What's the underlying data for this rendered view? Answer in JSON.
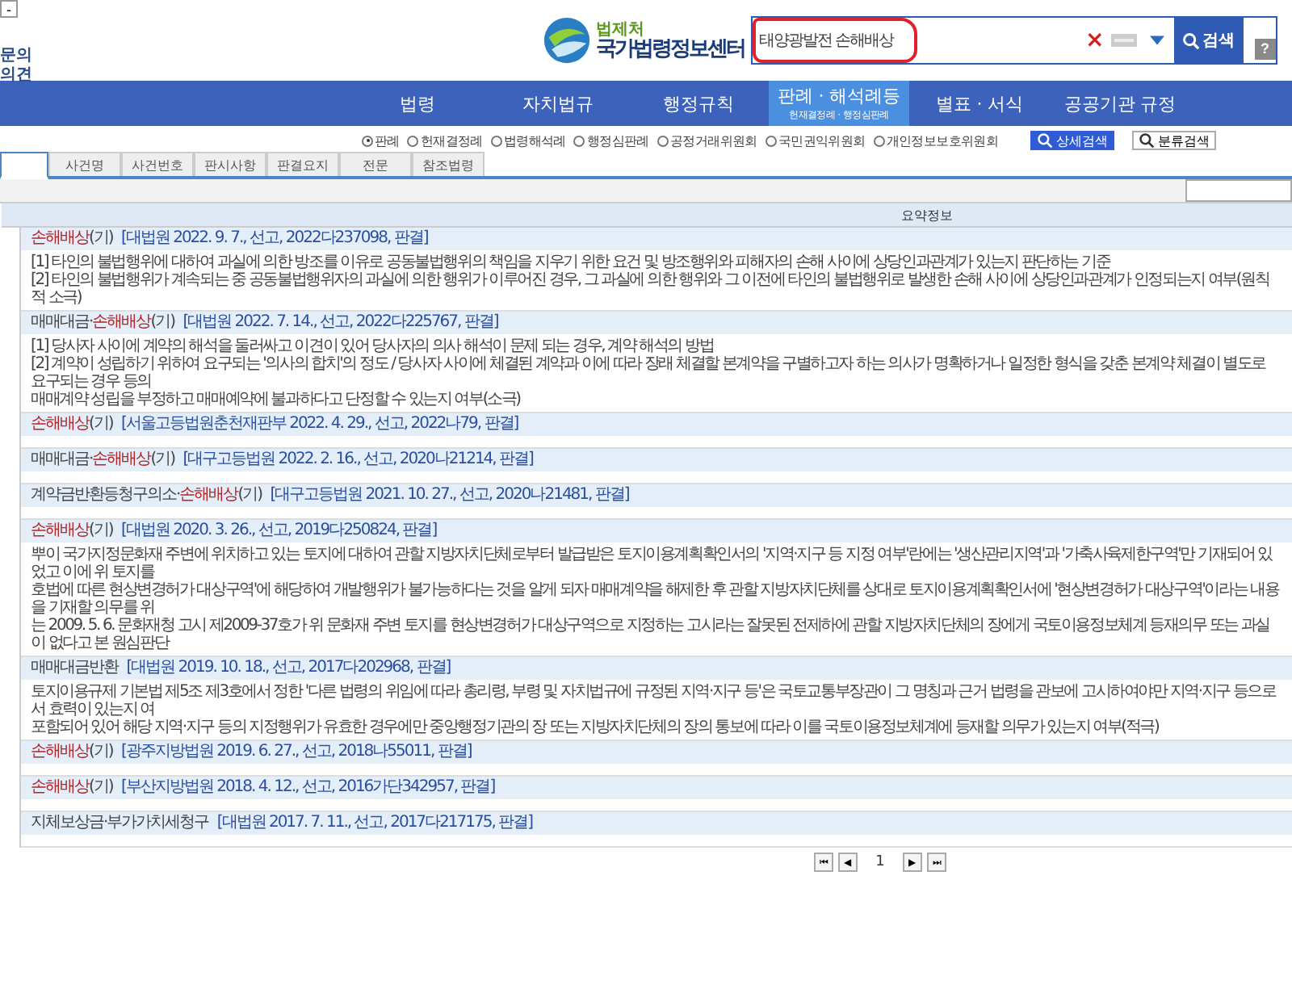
{
  "corner": {
    "button": "-",
    "links": [
      "문의",
      "의견"
    ]
  },
  "logo": {
    "ministry": "법제처",
    "name": "국가법령정보센터"
  },
  "search": {
    "value": "태양광발전 손해배상",
    "clear": "×",
    "button": "검색",
    "help": "?"
  },
  "nav": [
    {
      "label": "법령",
      "selected": false
    },
    {
      "label": "자치법규",
      "selected": false
    },
    {
      "label": "행정규칙",
      "selected": false
    },
    {
      "label": "판례 · 해석례등",
      "sub": "헌재결정례 · 행정심판례",
      "selected": true
    },
    {
      "label": "별표 · 서식",
      "selected": false
    },
    {
      "label": "공공기관 규정",
      "selected": false
    }
  ],
  "categories": [
    {
      "label": "판례",
      "selected": true
    },
    {
      "label": "헌재결정례",
      "selected": false
    },
    {
      "label": "법령해석례",
      "selected": false
    },
    {
      "label": "행정심판례",
      "selected": false
    },
    {
      "label": "공정거래위원회",
      "selected": false
    },
    {
      "label": "국민권익위원회",
      "selected": false
    },
    {
      "label": "개인정보보호위원회",
      "selected": false
    }
  ],
  "actions": [
    {
      "label": "상세검색",
      "kind": "primary"
    },
    {
      "label": "분류검색",
      "kind": "plain"
    }
  ],
  "tabs": [
    {
      "selected": true
    },
    {
      "label": "사건명",
      "selected": false
    },
    {
      "label": "사건번호",
      "selected": false
    },
    {
      "label": "판시사항",
      "selected": false
    },
    {
      "label": "판결요지",
      "selected": false
    },
    {
      "label": "전문",
      "selected": false
    },
    {
      "label": "참조법령",
      "selected": false
    }
  ],
  "table": {
    "header": "요약정보",
    "rows": [
      {
        "title": [
          {
            "text": "손해배상",
            "hit": true
          },
          {
            "text": "(기)",
            "hit": false
          }
        ],
        "citation": "[대법원 2022. 9. 7., 선고, 2022다237098, 판결]",
        "lines": [
          "[1] 타인의 불법행위에 대하여 과실에 의한 방조를 이유로 공동불법행위의 책임을 지우기 위한 요건 및 방조행위와 피해자의 손해 사이에 상당인과관계가 있는지 판단하는 기준",
          "[2] 타인의 불법행위가 계속되는 중 공동불법행위자의 과실에 의한 행위가 이루어진 경우, 그 과실에 의한 행위와 그 이전에 타인의 불법행위로 발생한 손해 사이에 상당인과관계가 인정되는지 여부(원칙적 소극)"
        ]
      },
      {
        "title": [
          {
            "text": "매매대금·",
            "hit": false
          },
          {
            "text": "손해배상",
            "hit": true
          },
          {
            "text": "(기)",
            "hit": false
          }
        ],
        "citation": "[대법원 2022. 7. 14., 선고, 2022다225767, 판결]",
        "lines": [
          "[1] 당사자 사이에 계약의 해석을 둘러싸고 이견이 있어 당사자의 의사 해석이 문제 되는 경우, 계약 해석의 방법",
          "[2] 계약이 성립하기 위하여 요구되는 '의사의 합치'의 정도 / 당사자 사이에 체결된 계약과 이에 따라 장래 체결할 본계약을 구별하고자 하는 의사가 명확하거나 일정한 형식을 갖춘 본계약 체결이 별도로 요구되는 경우 등의",
          "매매계약 성립을 부정하고 매매예약에 불과하다고 단정할 수 있는지 여부(소극)"
        ]
      },
      {
        "title": [
          {
            "text": "손해배상",
            "hit": true
          },
          {
            "text": "(기)",
            "hit": false
          }
        ],
        "citation": "[서울고등법원춘천재판부 2022. 4. 29., 선고, 2022나79, 판결]"
      },
      {
        "title": [
          {
            "text": "매매대금·",
            "hit": false
          },
          {
            "text": "손해배상",
            "hit": true
          },
          {
            "text": "(기)",
            "hit": false
          }
        ],
        "citation": "[대구고등법원 2022. 2. 16., 선고, 2020나21214, 판결]"
      },
      {
        "title": [
          {
            "text": "계약금반환등청구의소·",
            "hit": false
          },
          {
            "text": "손해배상",
            "hit": true
          },
          {
            "text": "(기)",
            "hit": false
          }
        ],
        "citation": "[대구고등법원 2021. 10. 27., 선고, 2020나21481, 판결]"
      },
      {
        "title": [
          {
            "text": "손해배상",
            "hit": true
          },
          {
            "text": "(기)",
            "hit": false
          }
        ],
        "citation": "[대법원 2020. 3. 26., 선고, 2019다250824, 판결]",
        "lines": [
          "뿌이 국가지정문화재 주변에 위치하고 있는 토지에 대하여 관할 지방자치단체로부터 발급받은 토지이용계획확인서의 '지역·지구 등 지정 여부'란에는 '생산관리지역'과 '가축사육제한구역'만 기재되어 있었고 이에 위 토지를",
          "호법에 따른 현상변경허가 대상구역'에 해당하여 개발행위가 불가능하다는 것을 알게 되자 매매계약을 해제한 후 관할 지방자치단체를 상대로 토지이용계획확인서에 '현상변경허가 대상구역'이라는 내용을 기재할 의무를 위",
          "는 2009. 5. 6. 문화재청 고시 제2009-37호가 위 문화재 주변 토지를 현상변경허가 대상구역으로 지정하는 고시라는 잘못된 전제하에 관할 지방자치단체의 장에게 국토이용정보체계 등재의무 또는 과실이 없다고 본 원심판단"
        ]
      },
      {
        "title": [
          {
            "text": "매매대금반환",
            "hit": false
          }
        ],
        "citation": "[대법원 2019. 10. 18., 선고, 2017다202968, 판결]",
        "lines": [
          "토지이용규제 기본법 제5조 제3호에서 정한 '다른 법령의 위임에 따라 총리령, 부령 및 자치법규에 규정된 지역·지구 등'은 국토교통부장관이 그 명칭과 근거 법령을 관보에 고시하여야만 지역·지구 등으로서 효력이 있는지 여",
          "포함되어 있어 해당 지역·지구 등의 지정행위가 유효한 경우에만 중앙행정기관의 장 또는 지방자치단체의 장의 통보에 따라 이를 국토이용정보체계에 등재할 의무가 있는지 여부(적극)"
        ]
      },
      {
        "title": [
          {
            "text": "손해배상",
            "hit": true
          },
          {
            "text": "(기)",
            "hit": false
          }
        ],
        "citation": "[광주지방법원 2019. 6. 27., 선고, 2018나55011, 판결]"
      },
      {
        "title": [
          {
            "text": "손해배상",
            "hit": true
          },
          {
            "text": "(기)",
            "hit": false
          }
        ],
        "citation": "[부산지방법원 2018. 4. 12., 선고, 2016가단342957, 판결]"
      },
      {
        "title": [
          {
            "text": "지체보상금·부가가치세청구",
            "hit": false
          }
        ],
        "citation": "[대법원 2017. 7. 11., 선고, 2017다217175, 판결]"
      }
    ]
  },
  "pagination": {
    "first": "⏮",
    "prev": "◀",
    "pages": [
      {
        "label": "1",
        "selected": true
      }
    ],
    "next": "▶",
    "last": "⏭"
  }
}
